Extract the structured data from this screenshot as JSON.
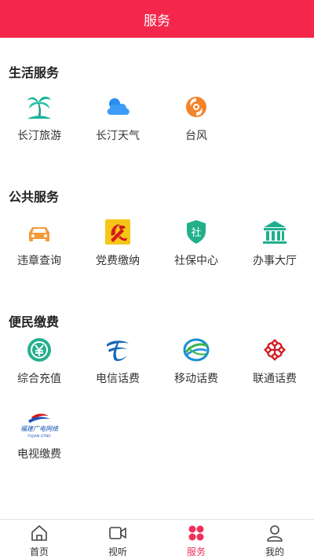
{
  "header": {
    "title": "服务"
  },
  "colors": {
    "brand": "#f5264b",
    "active_tab": "#f0305a"
  },
  "sections": [
    {
      "title": "生活服务",
      "items": [
        {
          "label": "长汀旅游",
          "icon": "palm-tree-icon"
        },
        {
          "label": "长汀天气",
          "icon": "cloud-icon"
        },
        {
          "label": "台风",
          "icon": "typhoon-icon"
        }
      ]
    },
    {
      "title": "公共服务",
      "items": [
        {
          "label": "违章查询",
          "icon": "car-icon"
        },
        {
          "label": "党费缴纳",
          "icon": "party-emblem-icon"
        },
        {
          "label": "社保中心",
          "icon": "shield-icon",
          "icon_text": "社"
        },
        {
          "label": "办事大厅",
          "icon": "government-hall-icon"
        }
      ]
    },
    {
      "title": "便民缴费",
      "items": [
        {
          "label": "综合充值",
          "icon": "recharge-icon"
        },
        {
          "label": "电信话费",
          "icon": "china-telecom-icon"
        },
        {
          "label": "移动话费",
          "icon": "china-mobile-icon"
        },
        {
          "label": "联通话费",
          "icon": "china-unicom-icon"
        },
        {
          "label": "电视缴费",
          "icon": "fujian-cable-tv-icon",
          "logo_text": "福建广电网络",
          "logo_subtext": "FUJIAN GTNG"
        }
      ]
    }
  ],
  "tabbar": {
    "tabs": [
      {
        "label": "首页",
        "icon": "home-icon"
      },
      {
        "label": "视听",
        "icon": "video-icon"
      },
      {
        "label": "服务",
        "icon": "grid-dots-icon",
        "active": true
      },
      {
        "label": "我的",
        "icon": "user-icon"
      }
    ]
  }
}
